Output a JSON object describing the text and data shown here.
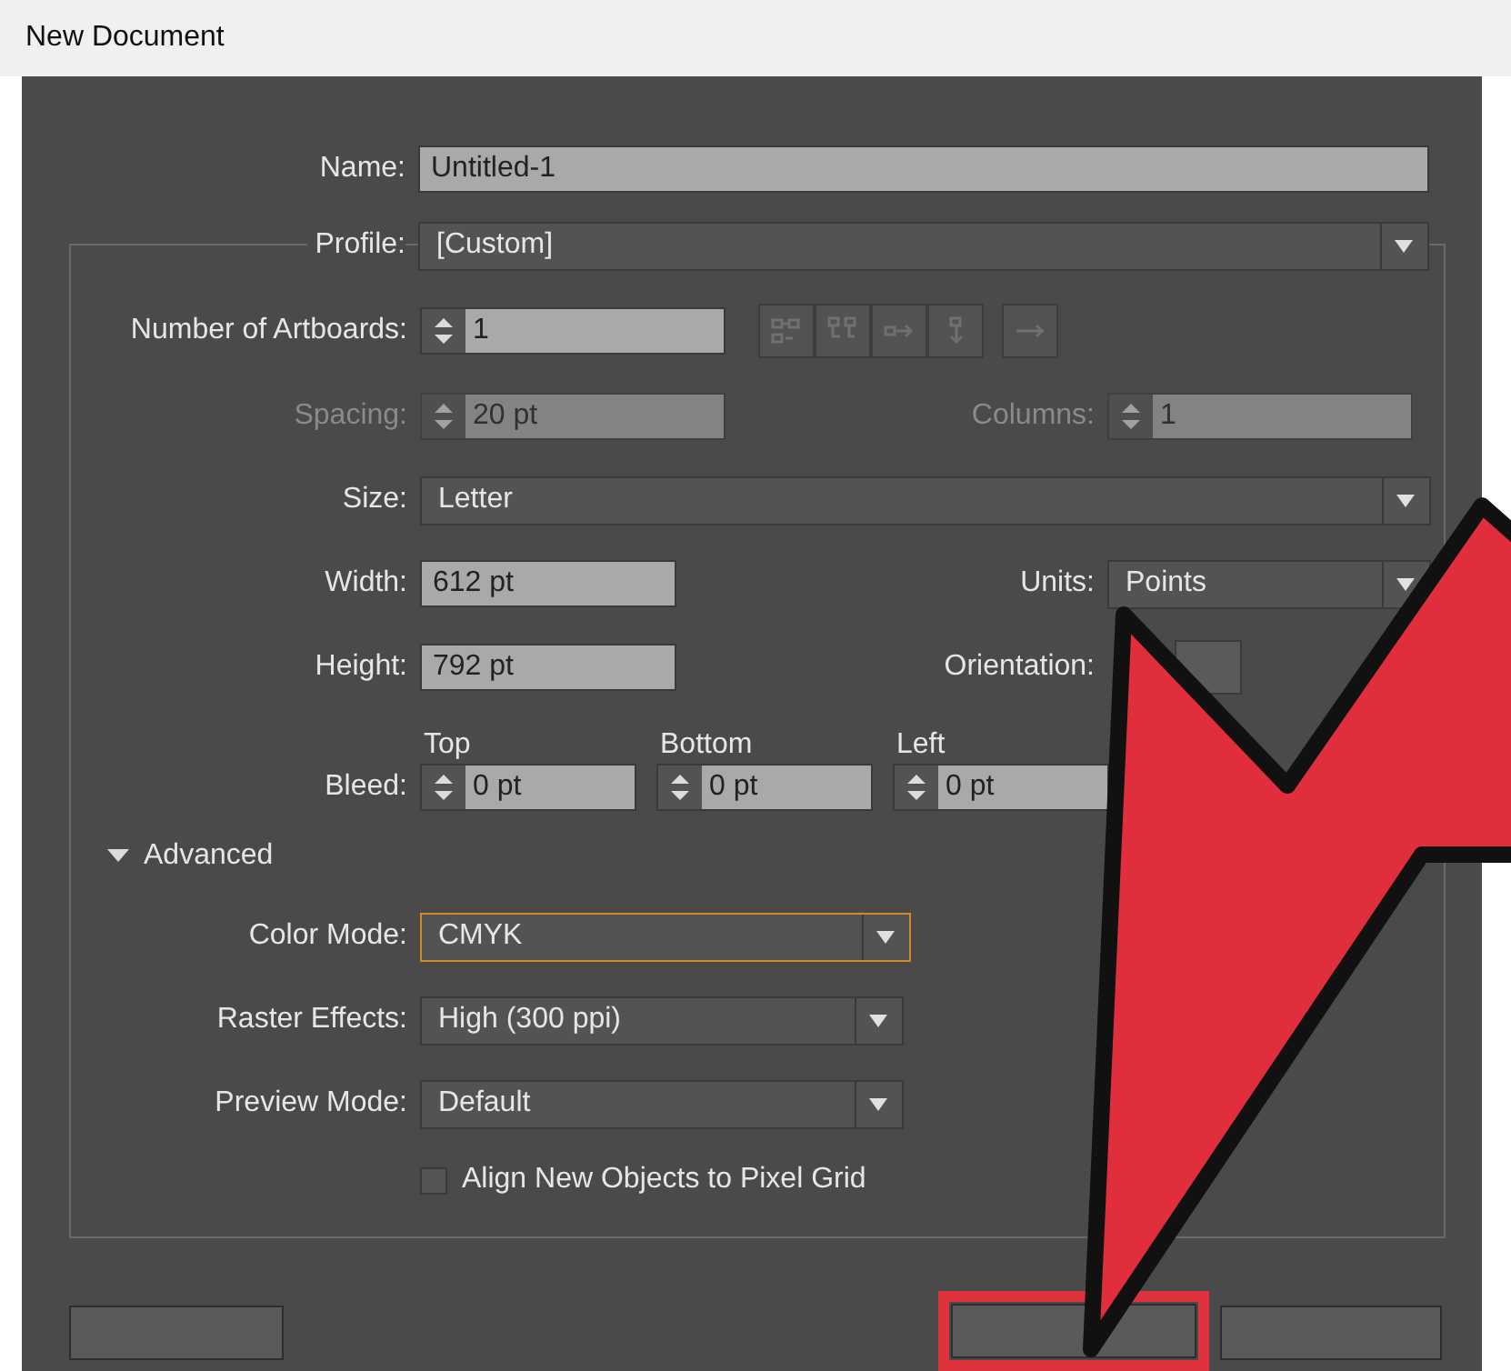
{
  "window": {
    "title": "New Document"
  },
  "name": {
    "label": "Name:",
    "value": "Untitled-1"
  },
  "profile": {
    "label": "Profile:",
    "value": "[Custom]"
  },
  "artboards": {
    "label": "Number of Artboards:",
    "value": "1"
  },
  "spacing": {
    "label": "Spacing:",
    "value": "20 pt",
    "disabled": true
  },
  "columns": {
    "label": "Columns:",
    "value": "1",
    "disabled": true
  },
  "size": {
    "label": "Size:",
    "value": "Letter"
  },
  "width": {
    "label": "Width:",
    "value": "612 pt"
  },
  "units": {
    "label": "Units:",
    "value": "Points"
  },
  "height": {
    "label": "Height:",
    "value": "792 pt"
  },
  "orientation": {
    "label": "Orientation:"
  },
  "bleed": {
    "label": "Bleed:",
    "fields": [
      {
        "heading": "Top",
        "value": "0 pt"
      },
      {
        "heading": "Bottom",
        "value": "0 pt"
      },
      {
        "heading": "Left",
        "value": "0 pt"
      }
    ]
  },
  "advanced": {
    "label": "Advanced",
    "expanded": true
  },
  "color_mode": {
    "label": "Color Mode:",
    "value": "CMYK",
    "focused": true
  },
  "raster_effects": {
    "label": "Raster Effects:",
    "value": "High (300 ppi)",
    "focused": false
  },
  "preview_mode": {
    "label": "Preview Mode:",
    "value": "Default",
    "focused": false
  },
  "align_pixel_grid": {
    "label": "Align New Objects to Pixel Grid",
    "checked": false
  },
  "highlight": {
    "kind": "arrow"
  }
}
